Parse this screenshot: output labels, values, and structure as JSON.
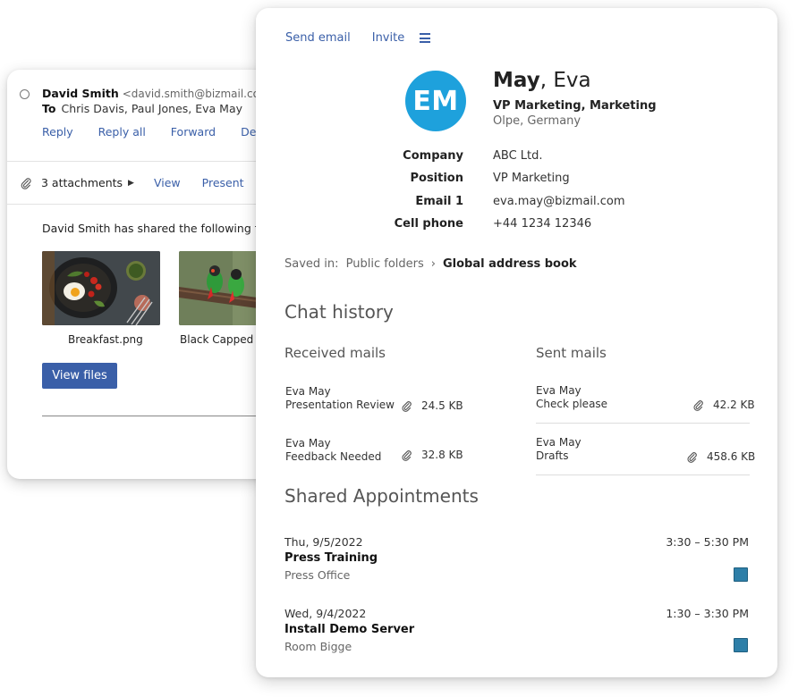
{
  "email": {
    "sender_name": "David Smith",
    "sender_address": "<david.smith@bizmail.com",
    "to_label": "To",
    "recipients": "Chris Davis, Paul Jones, Eva May",
    "actions": [
      "Reply",
      "Reply all",
      "Forward",
      "Delete"
    ],
    "attachments_label": "3 attachments",
    "view_label": "View",
    "present_label": "Present",
    "shared_text": "David Smith has shared the following files",
    "files": [
      {
        "name": "Breakfast.png"
      },
      {
        "name": "Black Capped Lo"
      }
    ],
    "view_files_label": "View files"
  },
  "contact": {
    "topbar": {
      "send_email": "Send email",
      "invite": "Invite"
    },
    "initials": "EM",
    "last_name": "May",
    "first_name": ", Eva",
    "title_line": "VP Marketing, Marketing",
    "location": "Olpe, Germany",
    "fields": [
      {
        "label": "Company",
        "value": "ABC Ltd."
      },
      {
        "label": "Position",
        "value": "VP Marketing"
      },
      {
        "label": "Email 1",
        "value": "eva.may@bizmail.com"
      },
      {
        "label": "Cell phone",
        "value": "+44 1234 12346"
      }
    ],
    "saved_in_label": "Saved in:",
    "saved_path": [
      "Public folders",
      "Global address book"
    ],
    "chat_history_title": "Chat history",
    "received_title": "Received mails",
    "sent_title": "Sent mails",
    "received": [
      {
        "sender": "Eva May",
        "subject": "Presentation Review",
        "size": "24.5 KB"
      },
      {
        "sender": "Eva May",
        "subject": "Feedback Needed",
        "size": "32.8 KB"
      }
    ],
    "sent": [
      {
        "sender": "Eva May",
        "subject": "Check please",
        "size": "42.2 KB"
      },
      {
        "sender": "Eva May",
        "subject": "Drafts",
        "size": "458.6 KB"
      }
    ],
    "appointments_title": "Shared Appointments",
    "appointments": [
      {
        "date": "Thu, 9/5/2022",
        "time": "3:30 – 5:30 PM",
        "title": "Press Training",
        "location": "Press Office"
      },
      {
        "date": "Wed, 9/4/2022",
        "time": "1:30 – 3:30 PM",
        "title": "Install Demo Server",
        "location": "Room Bigge"
      }
    ]
  },
  "colors": {
    "accent": "#3a5fa8",
    "avatar": "#1ea1dc",
    "appointment_marker": "#2e7fa8"
  }
}
